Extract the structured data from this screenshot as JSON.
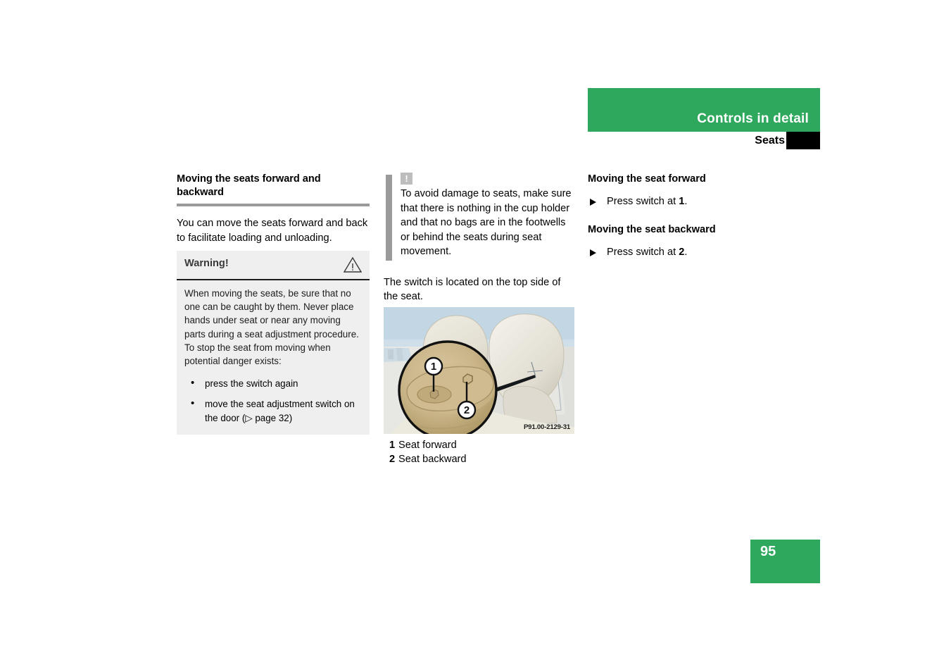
{
  "header": {
    "title": "Controls in detail",
    "subtitle": "Seats",
    "green_color": "#2ea85c",
    "tab_color": "#000000"
  },
  "column_left": {
    "section_title": "Moving the seats forward and backward",
    "intro": "You can move the seats forward and back to facilitate loading and unloading.",
    "warning": {
      "label": "Warning!",
      "icon": "warning-triangle-icon",
      "body": "When moving the seats, be sure that no one can be caught by them. Never place hands under seat or near any moving parts during a seat adjustment procedure. To stop the seat from moving when potential danger exists:",
      "bullets": [
        "press the switch again",
        "move the seat adjustment switch on the door (▷ page 32)"
      ],
      "bullet_glyph": "•"
    }
  },
  "column_center": {
    "note": {
      "icon_label": "!",
      "text": "To avoid damage to seats, make sure that there is nothing in the cup holder and that no bags are in the footwells or behind the seats during seat movement."
    },
    "after_note": "The switch is located on the top side of the seat.",
    "figure": {
      "image_code": "P91.00-2129-31",
      "callout_1": "1",
      "callout_2": "2",
      "alt": "Car seat with magnified circular inset showing the seat adjustment switch"
    },
    "legend": [
      {
        "num": "1",
        "label": "Seat forward"
      },
      {
        "num": "2",
        "label": "Seat backward"
      }
    ]
  },
  "column_right": {
    "section_1_title": "Moving the seat forward",
    "section_1_step_prefix": "Press switch at ",
    "section_1_step_ref": "1",
    "section_1_step_suffix": ".",
    "section_2_title": "Moving the seat backward",
    "section_2_step_prefix": "Press switch at ",
    "section_2_step_ref": "2",
    "section_2_step_suffix": "."
  },
  "footer": {
    "page_number": "95"
  }
}
